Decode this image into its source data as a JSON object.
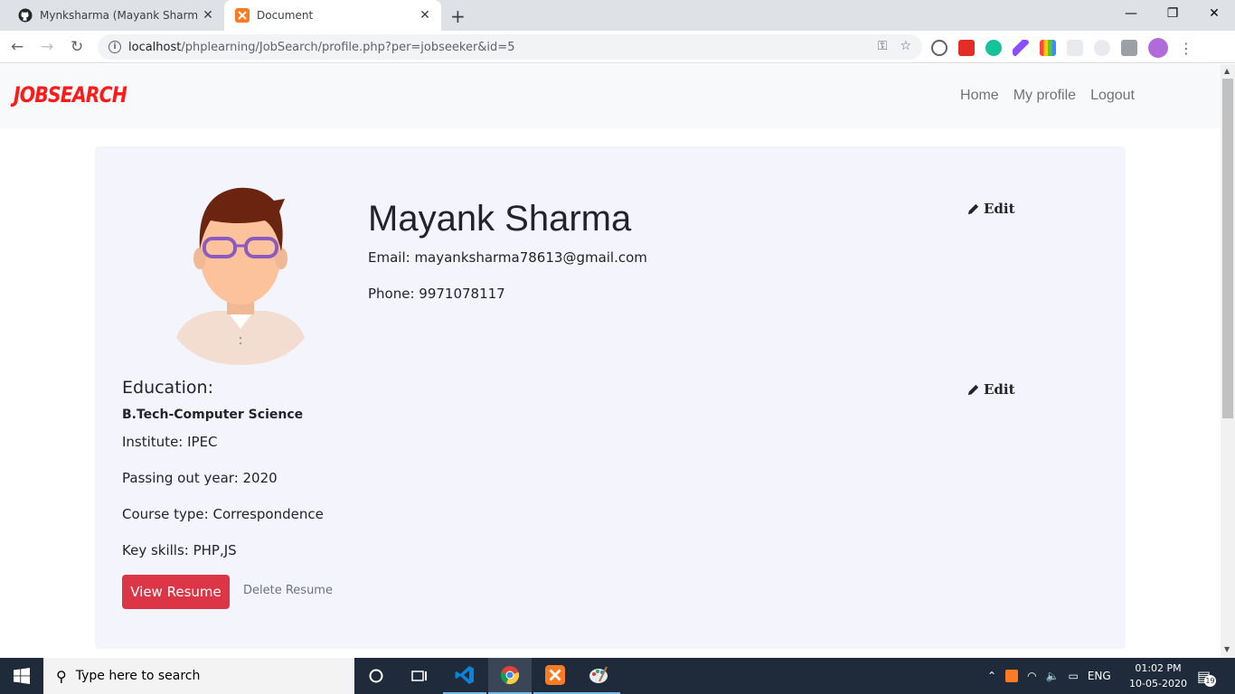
{
  "browser": {
    "tabs": [
      {
        "title": "Mynksharma (Mayank Sharma)",
        "icon": "github-icon",
        "active": false
      },
      {
        "title": "Document",
        "icon": "xampp-icon",
        "active": true
      }
    ],
    "url_host": "localhost",
    "url_path": "/phplearning/JobSearch/profile.php?per=jobseeker&id=5"
  },
  "site": {
    "brand": "JOBSEARCH",
    "brand_color": "#ff1a1a",
    "nav": [
      "Home",
      "My profile",
      "Logout"
    ]
  },
  "profile": {
    "name": "Mayank Sharma",
    "email": "Email: mayanksharma78613@gmail.com",
    "phone": "Phone: 9971078117",
    "edit_label": "Edit"
  },
  "education": {
    "title": "Education:",
    "degree": "B.Tech-Computer Science",
    "institute": "Institute: IPEC",
    "passing_year": "Passing out year: 2020",
    "course_type": "Course type: Correspondence",
    "skills": "Key skills: PHP,JS",
    "edit_label": "Edit",
    "view_resume": "View Resume",
    "delete_resume": "Delete Resume",
    "button_color": "#dc3545"
  },
  "taskbar": {
    "search_placeholder": "Type here to search",
    "language": "ENG",
    "time": "01:02 PM",
    "date": "10-05-2020",
    "notifications": "19"
  }
}
